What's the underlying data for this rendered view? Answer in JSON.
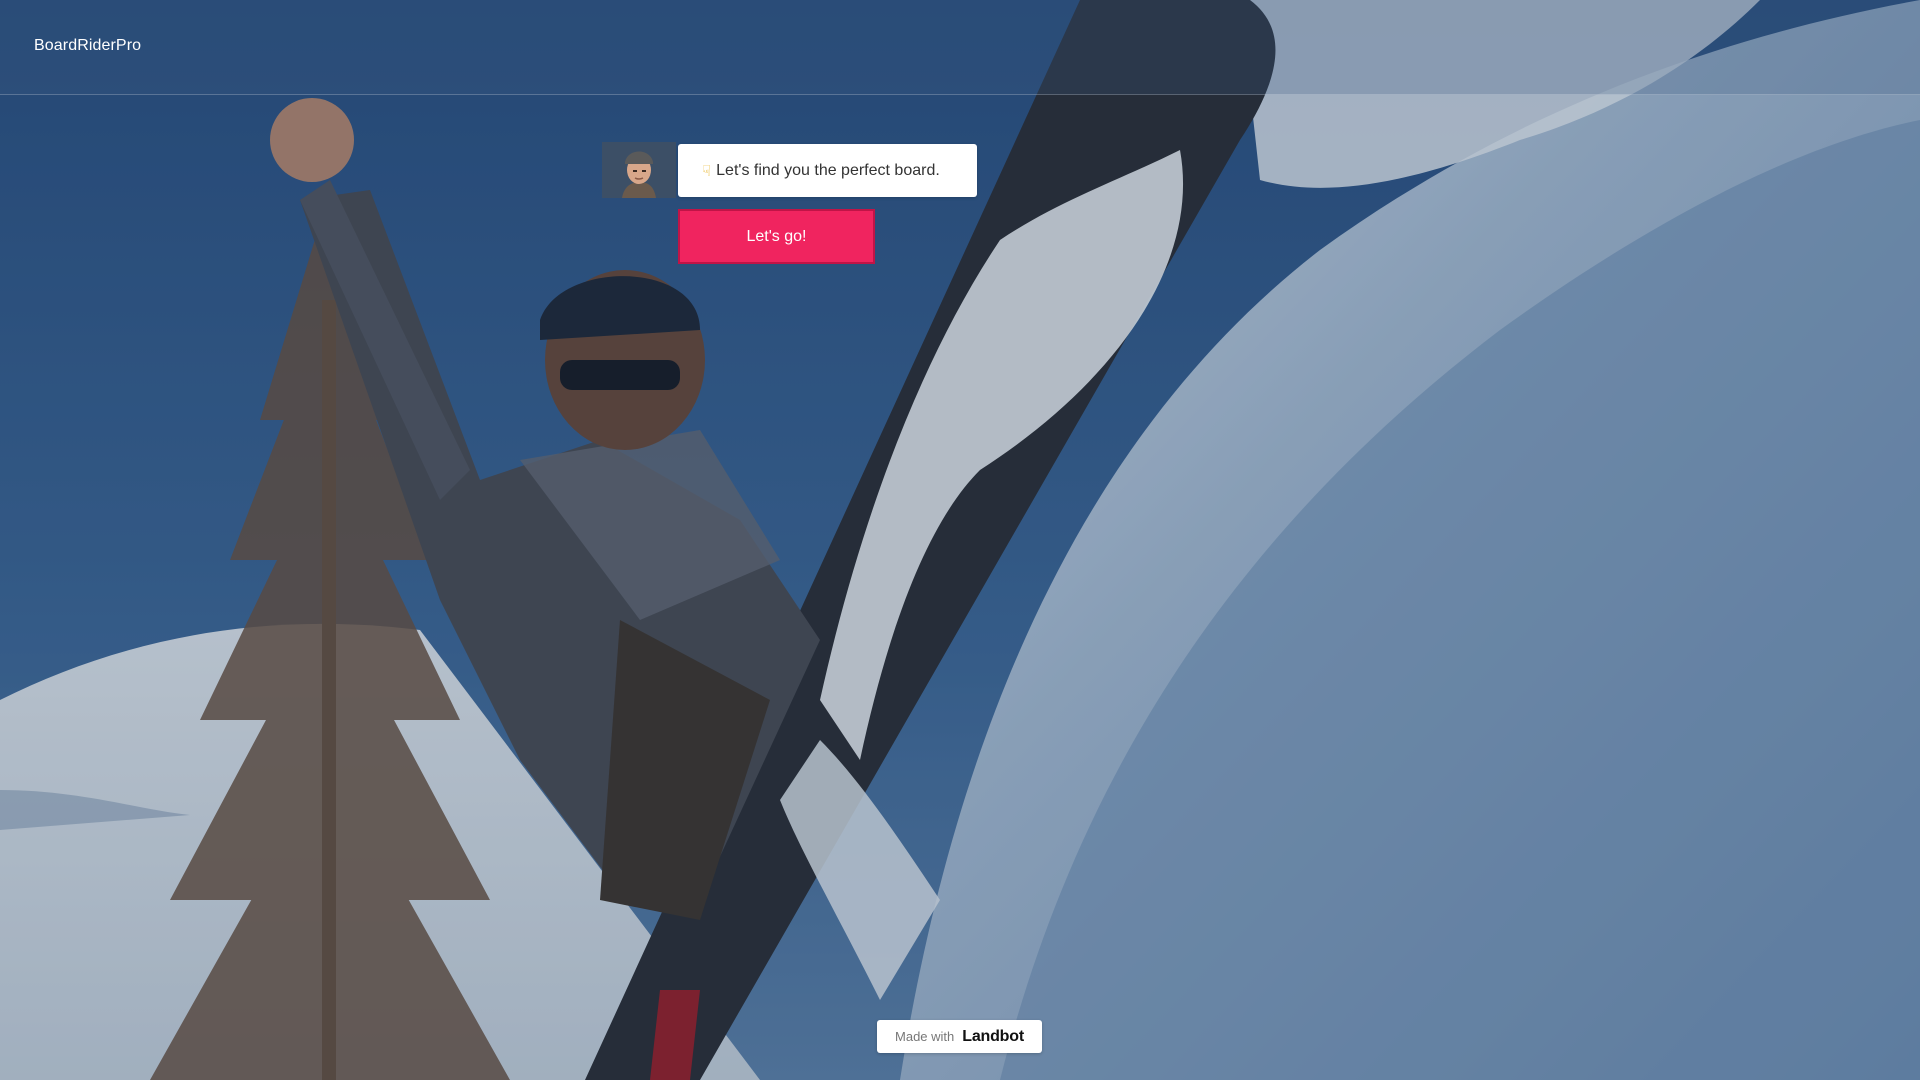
{
  "header": {
    "brand": "BoardRiderPro"
  },
  "chat": {
    "bot_message": "Let's find you the perfect board.",
    "bot_message_icon": "pointing-down-hand-icon",
    "button_label": "Let's go!"
  },
  "footer": {
    "made_with": "Made with",
    "platform": "Landbot"
  },
  "colors": {
    "cta_background": "#f0245f",
    "cta_border": "#c01447",
    "bubble_background": "#ffffff"
  }
}
